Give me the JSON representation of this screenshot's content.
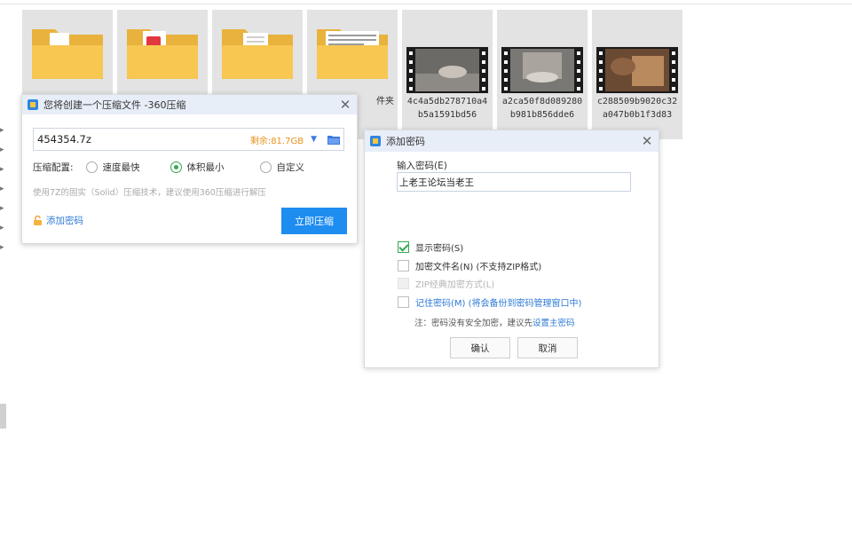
{
  "tiles": [
    {
      "kind": "folder",
      "doc": "white",
      "label": ""
    },
    {
      "kind": "folder",
      "doc": "red",
      "label": ""
    },
    {
      "kind": "folder",
      "doc": "white",
      "label": ""
    },
    {
      "kind": "folder",
      "doc": "text",
      "label": "件夹"
    },
    {
      "kind": "video",
      "label": "4c4a5db278710a4b5a1591bd56"
    },
    {
      "kind": "video",
      "label": "a2ca50f8d089280b981b856dde6"
    },
    {
      "kind": "video",
      "label": "c288509b9020c32a047b0b1f3d83"
    }
  ],
  "compress_dialog": {
    "title": "您将创建一个压缩文件 -360压缩",
    "close_glyph": "✕",
    "path_value": "454354.7z",
    "remaining": "剩余:81.7GB",
    "dropdown_glyph": "▼",
    "level_label": "压缩配置:",
    "options": [
      "速度最快",
      "体积最小",
      "自定义"
    ],
    "selected_option": "体积最小",
    "hint": "使用7Z的固实（Solid）压缩技术，建议使用360压缩进行解压",
    "add_password_link": "添加密码",
    "compress_button": "立即压缩"
  },
  "password_dialog": {
    "title": "添加密码",
    "close_glyph": "✕",
    "input_label": "输入密码(E)",
    "password_value": "上老王论坛当老王",
    "show_password": "显示密码(S)",
    "encrypt_filenames": "加密文件名(N) (不支持ZIP格式)",
    "zip_classic": "ZIP经典加密方式(L)",
    "remember_password": "记住密码(M) (将会备份到密码管理窗口中)",
    "note_prefix": "注：密码没有安全加密，建议先",
    "note_link": "设置主密码",
    "ok_button": "确认",
    "cancel_button": "取消"
  },
  "colors": {
    "accent": "#1e8df0",
    "check_green": "#34a853",
    "folder": "#f7c752",
    "remaining_orange": "#e8911c"
  }
}
